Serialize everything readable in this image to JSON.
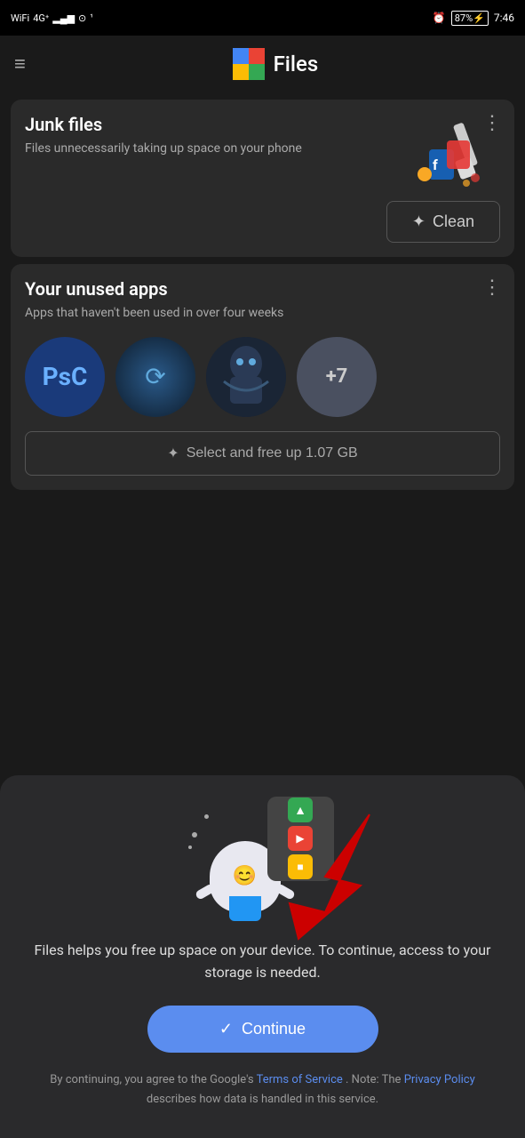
{
  "statusBar": {
    "left": "WiFi 4G signal",
    "time": "7:46",
    "battery": "87"
  },
  "appBar": {
    "menuIcon": "≡",
    "title": "Files"
  },
  "junkCard": {
    "title": "Junk files",
    "subtitle": "Files unnecessarily taking up space on your phone",
    "cleanButton": "Clean",
    "menuIcon": "⋮"
  },
  "unusedAppsCard": {
    "title": "Your unused apps",
    "subtitle": "Apps that haven't been used in over four weeks",
    "moreCount": "+7",
    "selectButton": "Select and free up 1.07 GB",
    "menuIcon": "⋮"
  },
  "modal": {
    "bodyText": "Files helps you free up space on your device. To continue, access to your storage is needed.",
    "continueButton": "Continue",
    "termsText": "By continuing, you agree to the Google's",
    "termsLink": "Terms of Service",
    "termsMiddle": ". Note: The",
    "privacyLink": "Privacy Policy",
    "termsEnd": "describes how data is handled in this service."
  },
  "icons": {
    "sparkle": "✦",
    "checkmark": "✓"
  }
}
